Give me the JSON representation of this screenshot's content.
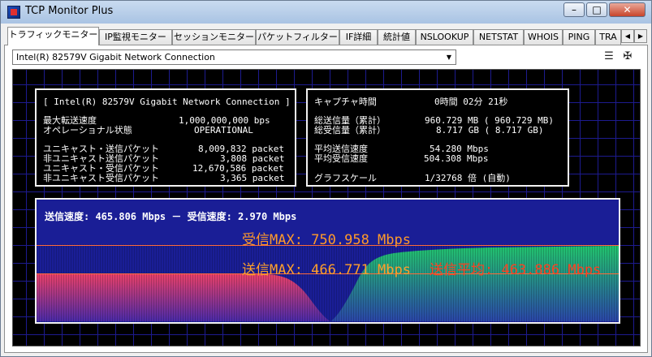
{
  "window": {
    "title": "TCP Monitor Plus",
    "minimize": "–",
    "maximize": "□",
    "close": "✕"
  },
  "tabs": [
    {
      "label": "トラフィックモニター"
    },
    {
      "label": "IP監視モニター"
    },
    {
      "label": "セッションモニター"
    },
    {
      "label": "パケットフィルター"
    },
    {
      "label": "IF詳細"
    },
    {
      "label": "統計値"
    },
    {
      "label": "NSLOOKUP"
    },
    {
      "label": "NETSTAT"
    },
    {
      "label": "WHOIS"
    },
    {
      "label": "PING"
    },
    {
      "label": "TRA"
    }
  ],
  "tab_scroll": {
    "left": "◀",
    "right": "▶"
  },
  "adapter": {
    "selected": "Intel(R) 82579V Gigabit Network Connection",
    "arrow": "▼"
  },
  "tools": {
    "list_icon": "☰",
    "pin_icon": "✠"
  },
  "left_box": {
    "header": "[ Intel(R) 82579V Gigabit Network Connection ]",
    "rows": [
      {
        "label": "最大転送速度",
        "value": "1,000,000,000 bps"
      },
      {
        "label": "オペレーショナル状態",
        "value": "OPERATIONAL"
      },
      {
        "label": "ユニキャスト・送信パケット",
        "value": "8,009,832 packet"
      },
      {
        "label": "非ユニキャスト送信パケット",
        "value": "3,808 packet"
      },
      {
        "label": "ユニキャスト・受信パケット",
        "value": "12,670,586 packet"
      },
      {
        "label": "非ユニキャスト受信パケット",
        "value": "3,365 packet"
      }
    ]
  },
  "right_box": {
    "capture_label": "キャプチャ時間",
    "capture_value": "0時間 02分 21秒",
    "rows": [
      {
        "label": "総送信量（累計）",
        "value": "960.729 MB ( 960.729 MB)"
      },
      {
        "label": "総受信量（累計）",
        "value": "8.717 GB (   8.717 GB)"
      },
      {
        "label": "平均送信速度",
        "value": "54.280 Mbps"
      },
      {
        "label": "平均受信速度",
        "value": "504.308 Mbps"
      },
      {
        "label": "グラフスケール",
        "value": "1/32768 倍 (自動)"
      }
    ]
  },
  "graph": {
    "speed_line": "送信速度: 465.806 Mbps  －  受信速度:   2.970 Mbps",
    "rx_max": "受信MAX: 750.958 Mbps",
    "tx_max": "送信MAX: 466.771 Mbps",
    "tx_avg": "送信平均: 463.886 Mbps",
    "colors": {
      "tx_fill": "#d8375a",
      "rx_fill": "#1fb86a",
      "max_line": "#ff6a3a",
      "rx_max_text": "#ff9a2a",
      "tx_max_text": "#ffa02a",
      "tx_avg_text": "#ff4020"
    }
  }
}
